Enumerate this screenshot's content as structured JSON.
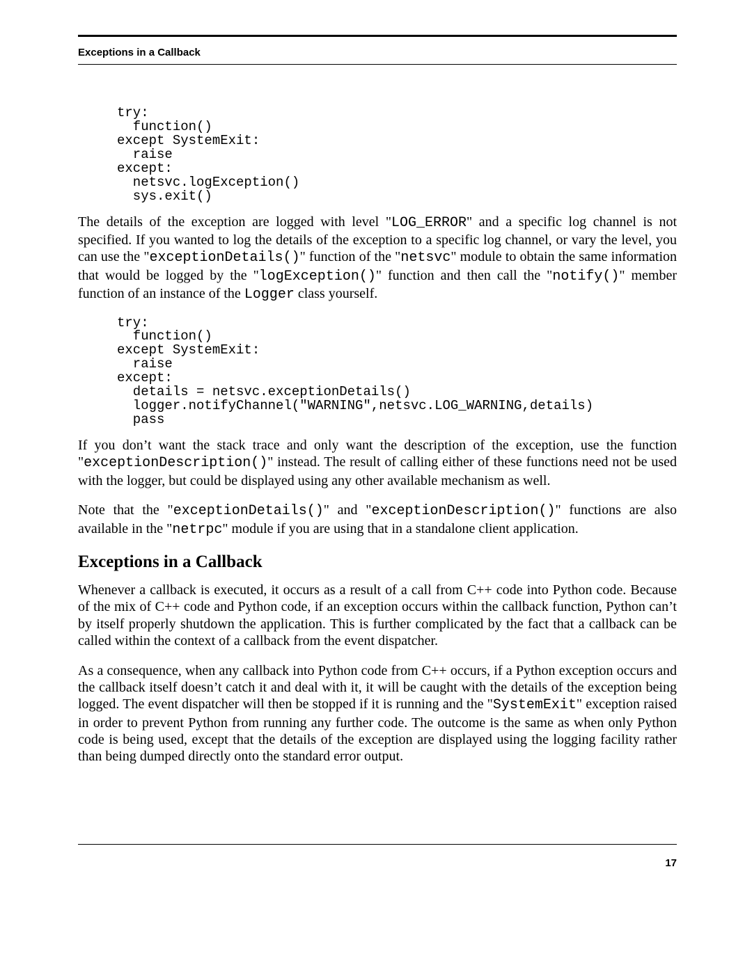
{
  "header": {
    "title": "Exceptions in a Callback"
  },
  "code1": "try:\n  function()\nexcept SystemExit:\n  raise\nexcept:\n  netsvc.logException()\n  sys.exit()",
  "para1": {
    "t1": "The details of the exception are logged with level \"",
    "c1": "LOG_ERROR",
    "t2": "\" and a specific log channel is not specified. If you wanted to log the details of the exception to a specific log channel, or vary the level, you can use the \"",
    "c2": "exceptionDetails()",
    "t3": "\" function of the \"",
    "c3": "netsvc",
    "t4": "\" module to obtain the same information that would be logged by the \"",
    "c4": "logException()",
    "t5": "\" function and then call the \"",
    "c5": "notify()",
    "t6": "\" member function of an instance of the ",
    "c6": "Logger",
    "t7": " class yourself."
  },
  "code2": "try:\n  function()\nexcept SystemExit:\n  raise\nexcept:\n  details = netsvc.exceptionDetails()\n  logger.notifyChannel(\"WARNING\",netsvc.LOG_WARNING,details)\n  pass",
  "para2": {
    "t1": "If you don’t want the stack trace and only want the description of the exception, use the function \"",
    "c1": "exceptionDescription()",
    "t2": "\" instead. The result of calling either of these functions need not be used with the logger, but could be displayed using any other available mechanism as well."
  },
  "para3": {
    "t1": "Note that the \"",
    "c1": "exceptionDetails()",
    "t2": "\" and \"",
    "c2": "exceptionDescription()",
    "t3": "\" functions are also available in the \"",
    "c3": "netrpc",
    "t4": "\" module if you are using that in a standalone client application."
  },
  "section_heading": "Exceptions in a Callback",
  "para4": "Whenever a callback is executed, it occurs as a result of a call from C++ code into Python code. Because of the mix of C++ code and Python code, if an exception occurs within the callback function, Python can’t by itself properly shutdown the application. This is further complicated by the fact that a callback can be called within the context of a callback from the event dispatcher.",
  "para5": {
    "t1": "As a consequence, when any callback into Python code from C++ occurs, if a Python exception occurs and the callback itself doesn’t catch it and deal with it, it will be caught with the details of the exception being logged. The event dispatcher will then be stopped if it is running and the \"",
    "c1": "SystemExit",
    "t2": "\" exception raised in order to prevent Python from running any further code. The outcome is the same as when only Python code is being used, except that the details of the exception are displayed using the logging facility rather than being dumped directly onto the standard error output."
  },
  "page_number": "17"
}
